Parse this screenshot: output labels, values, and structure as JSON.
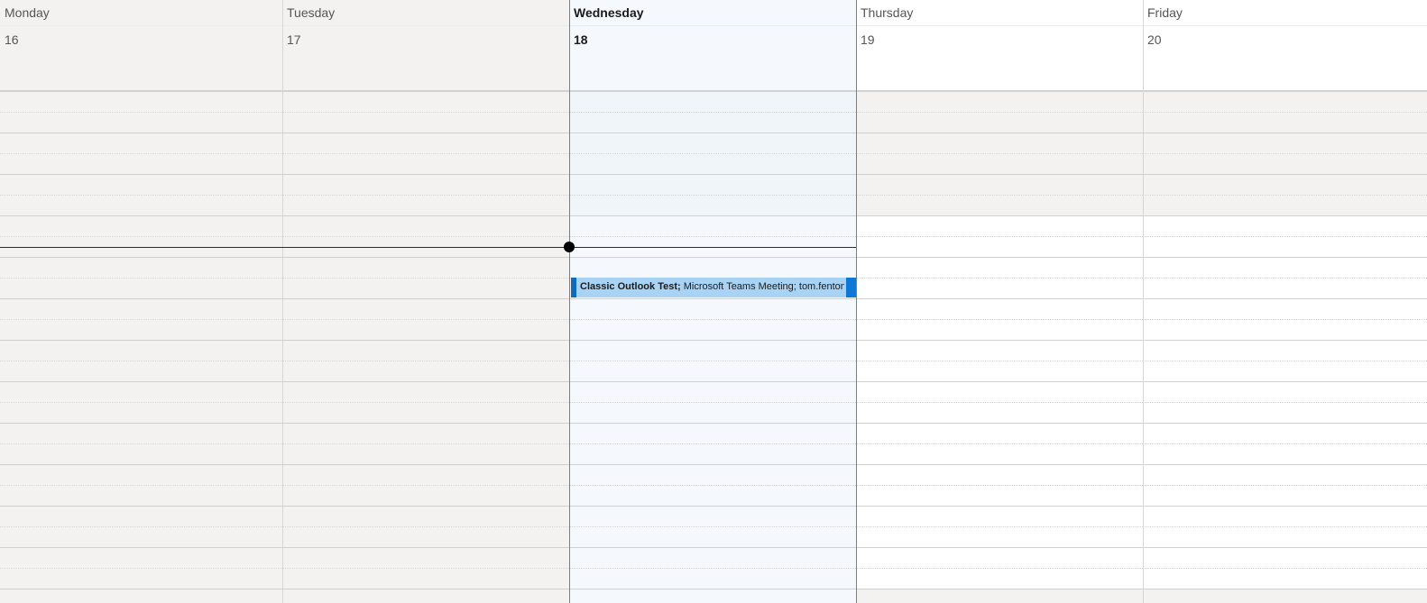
{
  "days": [
    {
      "name": "Monday",
      "number": "16"
    },
    {
      "name": "Tuesday",
      "number": "17"
    },
    {
      "name": "Wednesday",
      "number": "18",
      "today": true
    },
    {
      "name": "Thursday",
      "number": "19"
    },
    {
      "name": "Friday",
      "number": "20"
    }
  ],
  "event": {
    "title": "Classic Outlook Test;",
    "details": " Microsoft Teams Meeting; tom.fenton"
  },
  "colors": {
    "nonworking_bg": "#f3f2f1",
    "today_bg": "#f5f9fd",
    "today_worktime_bg": "#f0f5f9",
    "worktime_bg": "#ffffff",
    "today_border": "#3b8fd8",
    "event_bg": "#a9d3f5",
    "event_accent": "#0f6cbd"
  }
}
